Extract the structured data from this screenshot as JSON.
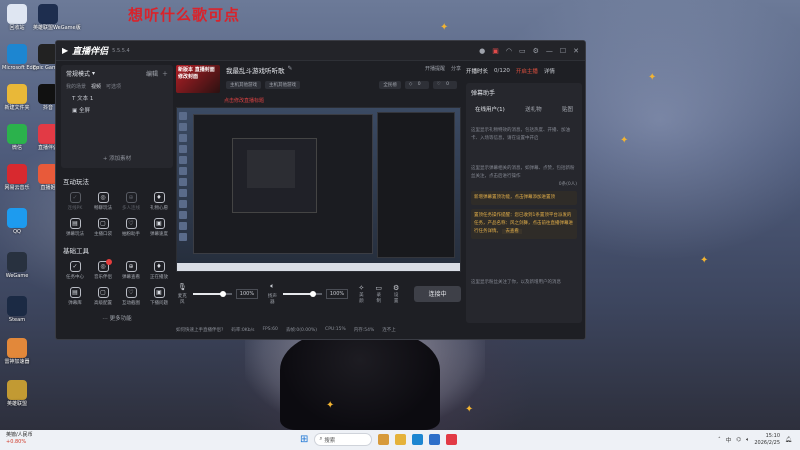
{
  "overlay": {
    "text": "想听什么歌可点"
  },
  "desktop": {
    "icons": [
      {
        "label": "回收站",
        "color": "#dfe6f2"
      },
      {
        "label": "英雄联盟WeGame版",
        "color": "#1e2e4f"
      },
      {
        "label": "Microsoft Edge",
        "color": "#1d86d1"
      },
      {
        "label": "Epic Games Launcher",
        "color": "#222222"
      },
      {
        "label": "新建文件夹",
        "color": "#e9b838"
      },
      {
        "label": "抖音",
        "color": "#111111"
      },
      {
        "label": "微信",
        "color": "#2bb24c"
      },
      {
        "label": "直播伴侣",
        "color": "#e23a45"
      },
      {
        "label": "网易云音乐",
        "color": "#d8292f"
      },
      {
        "label": "直播姬",
        "color": "#e85a3a"
      },
      {
        "label": "QQ",
        "color": "#1d9bef"
      },
      {
        "label": "WeGame",
        "color": "#28313f"
      },
      {
        "label": "Steam",
        "color": "#1b2a44"
      },
      {
        "label": "雷神加速器",
        "color": "#e2883a"
      },
      {
        "label": "英雄联盟",
        "color": "#c29a33"
      }
    ]
  },
  "app": {
    "title": "直播伴侣",
    "version": "5.5.5.4",
    "titlebar_icons": [
      "user-icon",
      "gift-icon",
      "headset-icon",
      "chat-icon",
      "settings-icon",
      "minimize-icon",
      "maximize-icon",
      "close-icon"
    ],
    "scene": {
      "mode": "常规模式",
      "edit": "编辑",
      "tabs": [
        "我的场景",
        "视频",
        "可选项"
      ],
      "sources": [
        "文本 1",
        "全屏"
      ],
      "add_material": "添加素材"
    },
    "interactive": {
      "title": "互动玩法",
      "items": [
        {
          "label": "连线PK",
          "dim": true
        },
        {
          "label": "畅聊玩法",
          "dim": false
        },
        {
          "label": "多人连线",
          "dim": true
        },
        {
          "label": "礼物心愿",
          "dim": false
        },
        {
          "label": "弹幕玩法",
          "dim": false
        },
        {
          "label": "主播口袋",
          "dim": false
        },
        {
          "label": "抽粉助手",
          "dim": false
        },
        {
          "label": "弹幕速度",
          "dim": false
        }
      ]
    },
    "tools": {
      "title": "基础工具",
      "items": [
        {
          "label": "任务中心",
          "badge": false
        },
        {
          "label": "音乐伴侣",
          "badge": true
        },
        {
          "label": "弹幕查看",
          "badge": false
        },
        {
          "label": "正在播放",
          "badge": false
        },
        {
          "label": "弹幕库",
          "badge": false
        },
        {
          "label": "高级配置",
          "badge": false
        },
        {
          "label": "互动截图",
          "badge": false
        },
        {
          "label": "下播问题",
          "badge": false
        }
      ],
      "more": "更多功能"
    },
    "stream": {
      "cover_text": "新版本 直播封面 修改封面",
      "title": "我最乱斗游戏听听歌",
      "tags": [
        "主机其他游戏",
        "主机其他游戏"
      ],
      "red_label": "点击修改直播标题",
      "header_actions": [
        "开播提醒",
        "分享"
      ],
      "viewers": "0",
      "likes": "0",
      "sort": "全民榜"
    },
    "controls": {
      "mic_label": "麦克风",
      "mic_pct": "100%",
      "mic_level": 0.72,
      "speaker_label": "扬声器",
      "speaker_pct": "100%",
      "speaker_level": 0.72,
      "actions": [
        {
          "label": "美颜",
          "icon": "beauty-icon"
        },
        {
          "label": "录制",
          "icon": "record-icon"
        },
        {
          "label": "设置",
          "icon": "gear-icon"
        }
      ],
      "start_button": "连接中"
    },
    "status": [
      "如何快速上手直播伴侣?",
      "码率:0Kb/s",
      "FPS:60",
      "丢帧:0(0.00%)",
      "CPU:15%",
      "内存:54%",
      "连不上"
    ],
    "right": {
      "online_label": "开播时长",
      "count": "0/120",
      "warn": "开启主播",
      "detail": "详情",
      "assistant_title": "弹幕助手",
      "tabs": [
        "在线用户(1)",
        "送礼物",
        "贴图"
      ],
      "gray1": "这里显示礼物特效的消息，包括热度、开播、加油卡、入场等信息，请在设置中开启",
      "gray2": "这里显示弹幕相关的消息，如弹幕、点赞，包括新粉丝关注，点击后进行操作",
      "count_badge": "0条(0人)",
      "notice1": "新增弹幕置顶功能，点击弹幕添加进置顶",
      "notice2": "置顶任务操作提醒：您已收到1条置顶平台派发的任务，产品名称：风之剑舞，点击前往直播弹幕进行任务详情。",
      "go_look": "去查看",
      "gray3": "这里显示粉丝关注了你，以及新增用户的消息"
    }
  },
  "taskbar": {
    "weather_title": "英镑/人民币",
    "weather_change": "+0.80%",
    "search": "搜索",
    "time": "15:10",
    "date": "2026/2/25",
    "lang": "中"
  }
}
